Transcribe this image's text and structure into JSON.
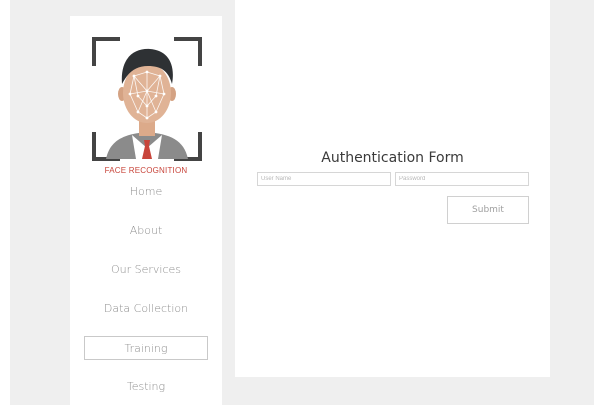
{
  "sidebar": {
    "brand": "FACE RECOGNITION",
    "logo_icon": "face-recognition-logo",
    "items": [
      {
        "label": "Home"
      },
      {
        "label": "About"
      },
      {
        "label": "Our Services"
      },
      {
        "label": "Data Collection"
      },
      {
        "label": "Training",
        "active": true
      },
      {
        "label": "Testing"
      }
    ]
  },
  "form": {
    "title": "Authentication Form",
    "username": {
      "placeholder": "User Name",
      "value": ""
    },
    "password": {
      "placeholder": "Password",
      "value": ""
    },
    "submit_label": "Submit"
  },
  "colors": {
    "background": "#efefef",
    "panel": "#ffffff",
    "brand_red": "#c8453b",
    "nav_text": "#8c8c8c"
  }
}
